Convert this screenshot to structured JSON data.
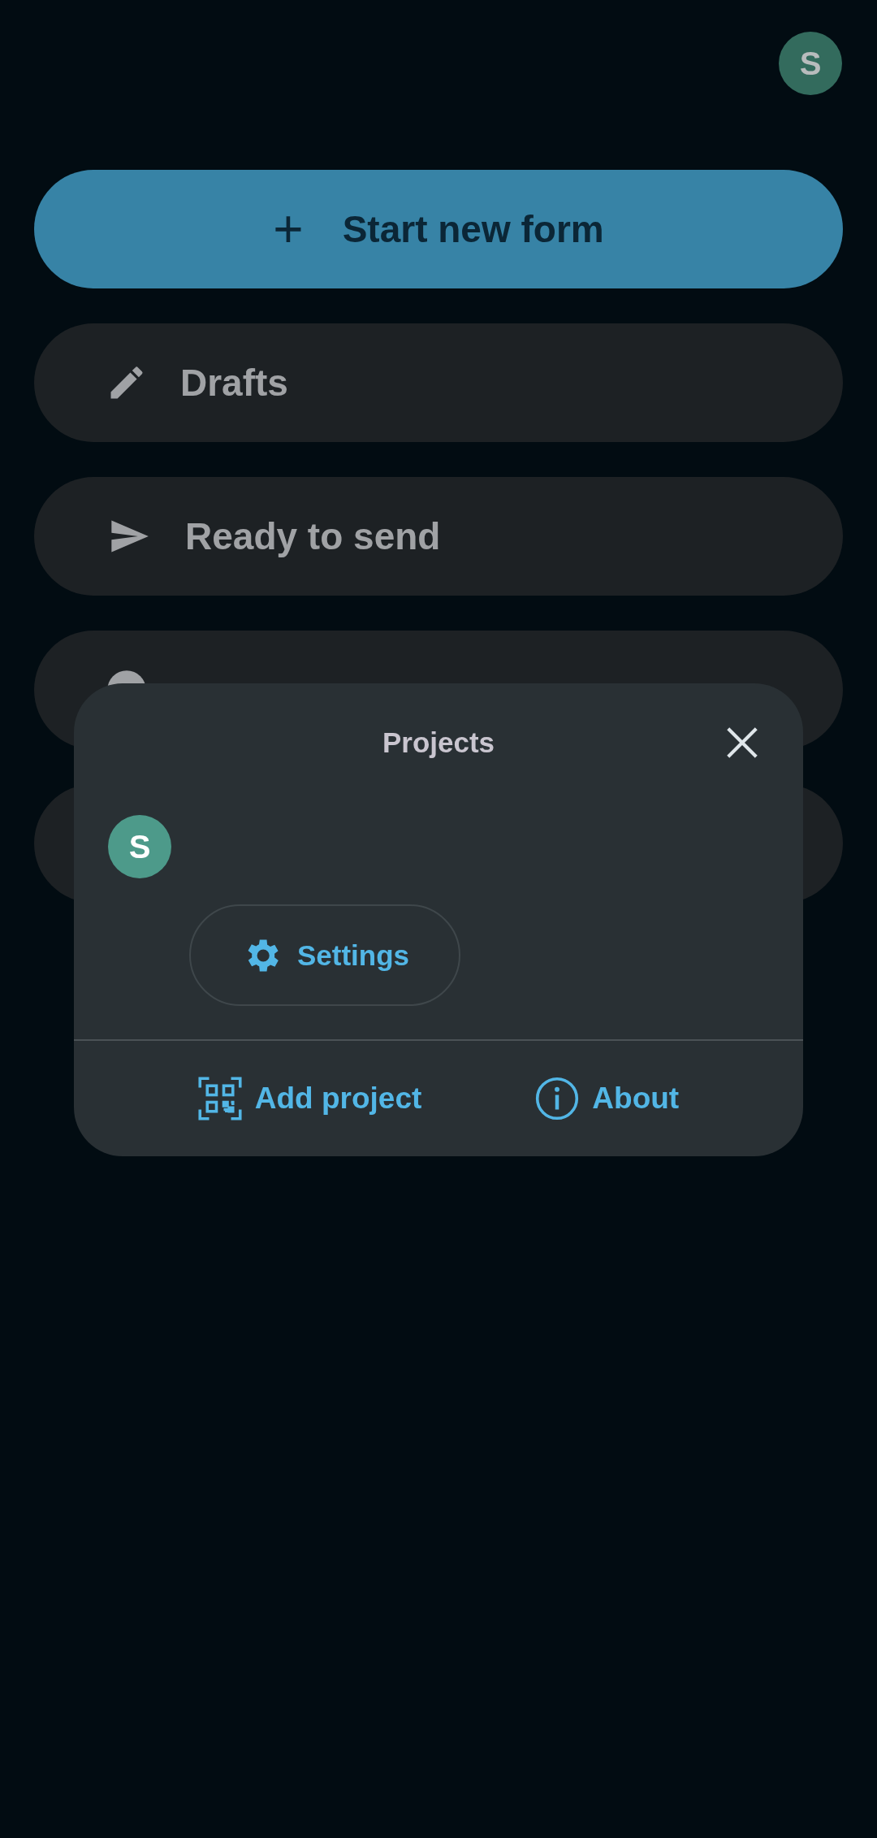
{
  "header": {
    "avatar_letter": "S"
  },
  "start_button": {
    "label": "Start new form",
    "icon": "+"
  },
  "menu": [
    {
      "kind": "drafts",
      "label": "Drafts"
    },
    {
      "kind": "ready",
      "label": "Ready to send"
    },
    {
      "kind": "sent"
    },
    {
      "kind": "other"
    }
  ],
  "dialog": {
    "title": "Projects",
    "project": {
      "avatar_letter": "S"
    },
    "settings_button": "Settings",
    "actions": [
      {
        "kind": "qr",
        "label": "Add project"
      },
      {
        "kind": "info",
        "label": "About"
      }
    ]
  }
}
